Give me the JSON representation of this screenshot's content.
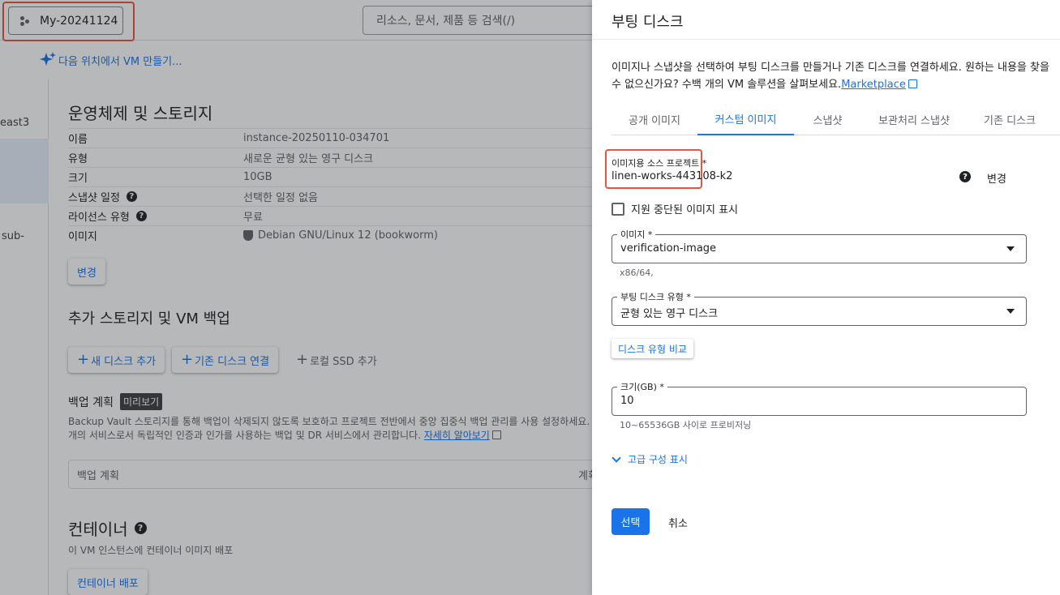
{
  "header": {
    "project_name": "My-20241124",
    "search_placeholder": "리소스, 문서, 제품 등 검색(/)",
    "create_vm_link": "다음 위치에서 VM 만들기..."
  },
  "left_column": {
    "item1": "east3",
    "item2": "sub-"
  },
  "os_storage": {
    "title": "운영체제 및 스토리지",
    "rows": [
      {
        "key": "이름",
        "value": "instance-20250110-034701"
      },
      {
        "key": "유형",
        "value": "새로운 균형 있는 영구 디스크"
      },
      {
        "key": "크기",
        "value": "10GB"
      },
      {
        "key": "스냅샷 일정",
        "value": "선택한 일정 없음"
      },
      {
        "key": "라이선스 유형",
        "value": "무료"
      },
      {
        "key": "이미지",
        "value": "Debian GNU/Linux 12 (bookworm)"
      }
    ],
    "change_button": "변경"
  },
  "extra_storage": {
    "title": "추가 스토리지 및 VM 백업",
    "add_disk_button": "새 디스크 추가",
    "attach_disk_button": "기존 디스크 연결",
    "add_ssd_button": "로컬 SSD 추가"
  },
  "backup": {
    "title": "백업 계획",
    "badge": "미리보기",
    "desc_line1": "Backup Vault 스토리지를 통해 백업이 삭제되지 않도록 보호하고 프로젝트 전반에서 중앙 집중식 백업 관리를 사용 설정하세요. Compute",
    "desc_line2": "개의 서비스로서 독립적인 인증과 인가를 사용하는 백업 및 DR 서비스에서 관리합니다.",
    "learn_more": "자세히 알아보기",
    "field_label": "백업 계획",
    "field_right": "계획"
  },
  "container": {
    "title": "컨테이너",
    "subtitle": "이 VM 인스턴스에 컨테이너 이미지 배포",
    "deploy_button": "컨테이너 배포"
  },
  "panel": {
    "title": "부팅 디스크",
    "desc": "이미지나 스냅샷을 선택하여 부팅 디스크를 만들거나 기존 디스크를 연결하세요. 원하는 내용을 찾을 수 없으신가요? 수백 개의 VM 솔루션을 살펴보세요.",
    "marketplace_link": "Marketplace",
    "tabs": [
      "공개 이미지",
      "커스텀 이미지",
      "스냅샷",
      "보관처리 스냅샷",
      "기존 디스크"
    ],
    "source_project_label": "이미지용 소스 프로젝트 *",
    "source_project_value": "linen-works-443108-k2",
    "change_link": "변경",
    "show_deprecated": "지원 중단된 이미지 표시",
    "image_label": "이미지 *",
    "image_value": "verification-image",
    "image_hint": "x86/64,",
    "disk_type_label": "부팅 디스크 유형 *",
    "disk_type_value": "균형 있는 영구 디스크",
    "compare_button": "디스크 유형 비교",
    "size_label": "크기(GB) *",
    "size_value": "10",
    "size_hint": "10~65536GB 사이로 프로비저닝",
    "advanced_link": "고급 구성 표시",
    "select_button": "선택",
    "cancel_button": "취소"
  }
}
